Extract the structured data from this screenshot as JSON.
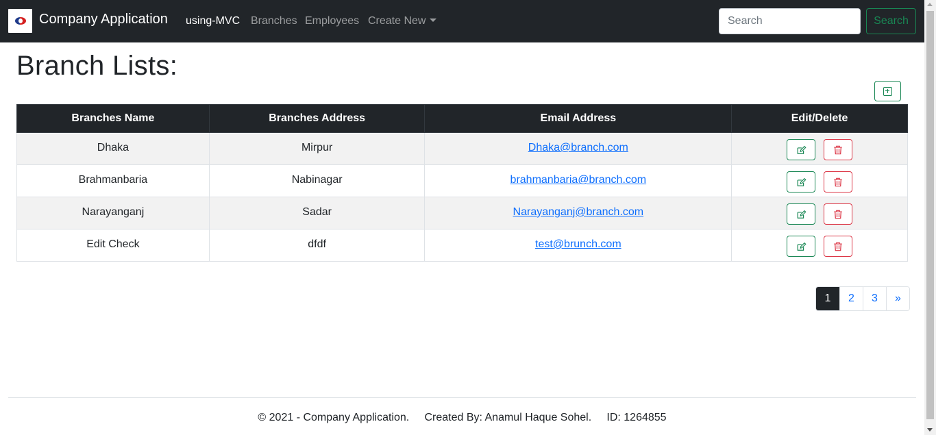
{
  "navbar": {
    "brand_title": "Company Application",
    "links": [
      {
        "label": "using-MVC",
        "active": true
      },
      {
        "label": "Branches",
        "active": false
      },
      {
        "label": "Employees",
        "active": false
      },
      {
        "label": "Create New",
        "active": false,
        "dropdown": true
      }
    ],
    "search_placeholder": "Search",
    "search_button": "Search"
  },
  "page": {
    "title": "Branch Lists:",
    "add_icon": "plus-square-icon"
  },
  "table": {
    "headers": [
      "Branches Name",
      "Branches Address",
      "Email Address",
      "Edit/Delete"
    ],
    "rows": [
      {
        "name": "Dhaka",
        "address": "Mirpur",
        "email": "Dhaka@branch.com"
      },
      {
        "name": "Brahmanbaria",
        "address": "Nabinagar",
        "email": "brahmanbaria@branch.com"
      },
      {
        "name": "Narayanganj",
        "address": "Sadar",
        "email": "Narayanganj@branch.com"
      },
      {
        "name": "Edit Check",
        "address": "dfdf",
        "email": "test@brunch.com"
      }
    ],
    "edit_icon": "pencil-square-icon",
    "delete_icon": "trash-icon"
  },
  "pagination": {
    "pages": [
      "1",
      "2",
      "3"
    ],
    "current": "1",
    "next": "»"
  },
  "footer": {
    "text": "© 2021 - Company Application.     Created By: Anamul Haque Sohel.     ID: 1264855"
  },
  "colors": {
    "navbar_bg": "#212529",
    "success": "#198754",
    "danger": "#dc3545",
    "link": "#0d6efd"
  }
}
